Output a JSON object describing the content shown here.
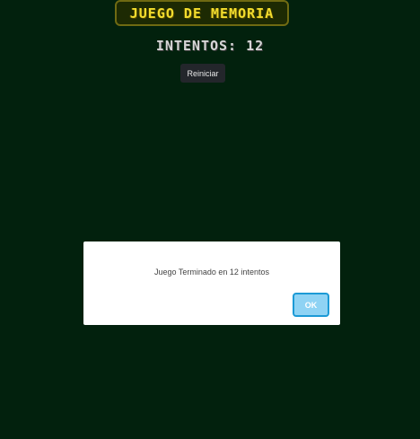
{
  "header": {
    "title": "Juego de Memoria",
    "attempts_text": "Intentos: 12"
  },
  "controls": {
    "reset_label": "Reiniciar"
  },
  "dialog": {
    "message": "Juego Terminado en 12 intentos",
    "ok_label": "OK"
  },
  "colors": {
    "background": "#02210d",
    "title_text": "#f2dd2e",
    "title_border": "#6f6a12",
    "ok_button_fill": "#8fd3f4",
    "ok_button_border": "#1c9ad6"
  }
}
